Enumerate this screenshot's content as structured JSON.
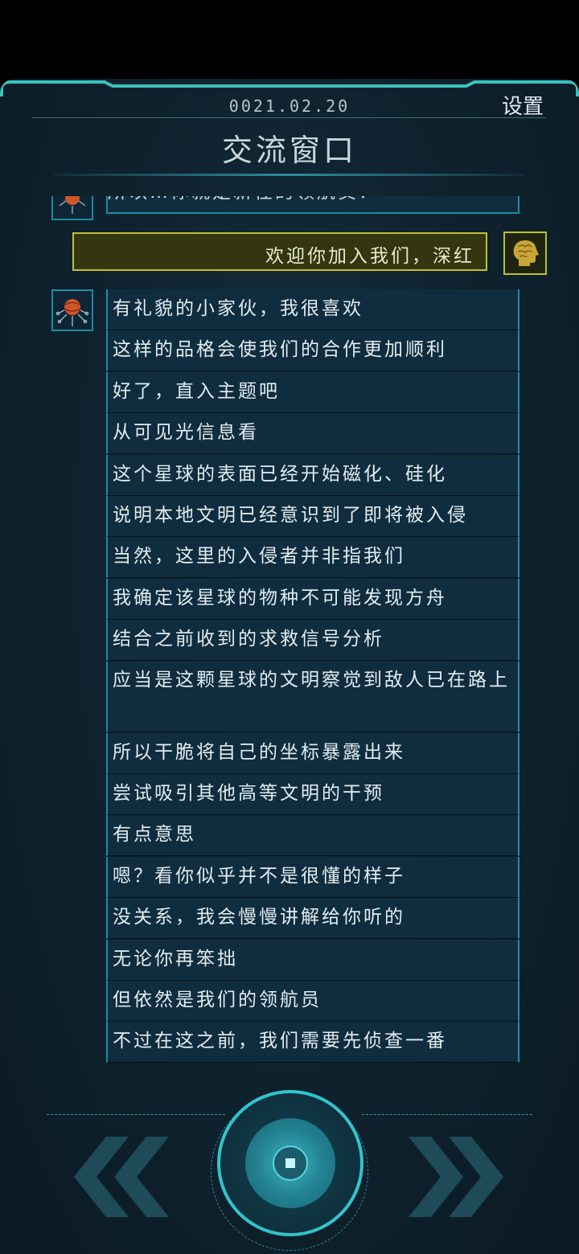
{
  "header": {
    "date": "0021.02.20",
    "settings_label": "设置",
    "title": "交流窗口"
  },
  "chat": {
    "partial_message": "所以…你就是新任的领航员？",
    "player_message": "欢迎你加入我们，深红",
    "alien_messages": [
      "有礼貌的小家伙，我很喜欢",
      "这样的品格会使我们的合作更加顺利",
      "好了，直入主题吧",
      "从可见光信息看",
      "这个星球的表面已经开始磁化、硅化",
      "说明本地文明已经意识到了即将被入侵",
      "当然，这里的入侵者并非指我们",
      "我确定该星球的物种不可能发现方舟",
      "结合之前收到的求救信号分析",
      "应当是这颗星球的文明察觉到敌人已在路上",
      "所以干脆将自己的坐标暴露出来",
      "尝试吸引其他高等文明的干预",
      "有点意思",
      "嗯？看你似乎并不是很懂的样子",
      "没关系，我会慢慢讲解给你听的",
      "无论你再笨拙",
      "但依然是我们的领航员",
      "不过在这之前，我们需要先侦查一番"
    ]
  },
  "icons": {
    "alien_avatar": "alien-planet-avatar-icon",
    "player_avatar": "player-head-avatar-icon",
    "prev": "double-chevron-left-icon",
    "next": "double-chevron-right-icon",
    "center": "center-dial-button"
  },
  "colors": {
    "accent_cyan": "#31c4cc",
    "bubble_bg": "#0f2d3e",
    "player_bubble_border": "#c0bf2e"
  }
}
